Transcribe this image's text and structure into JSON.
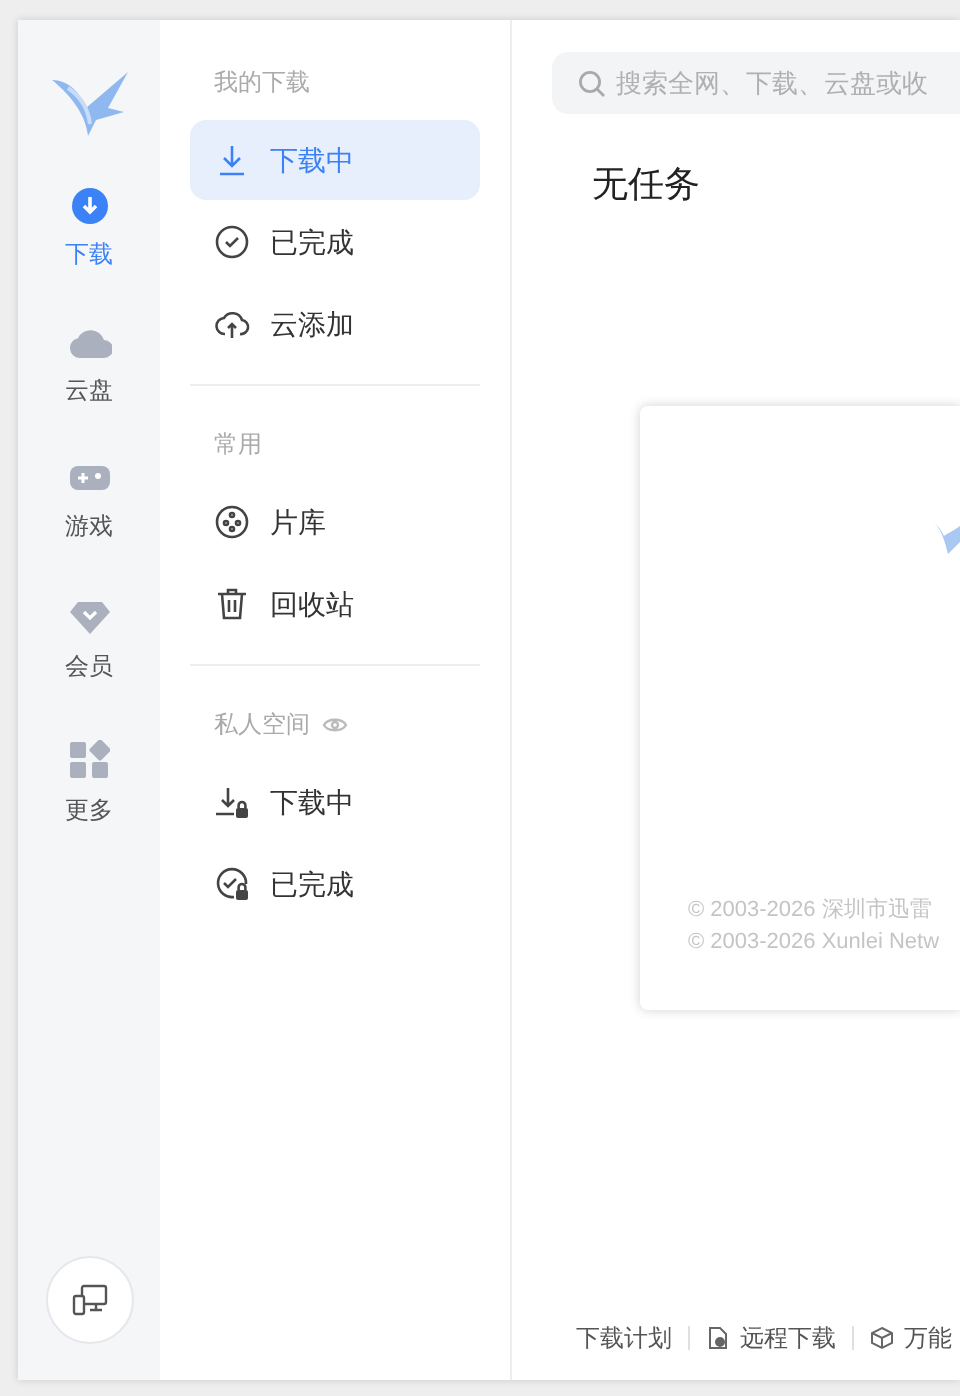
{
  "rail": [
    {
      "kind": "download",
      "label": "下载",
      "selected": true
    },
    {
      "kind": "cloud",
      "label": "云盘",
      "selected": false
    },
    {
      "kind": "game",
      "label": "游戏",
      "selected": false
    },
    {
      "kind": "vip",
      "label": "会员",
      "selected": false
    },
    {
      "kind": "more",
      "label": "更多",
      "selected": false
    }
  ],
  "sections": [
    {
      "title": "我的下载",
      "items": [
        {
          "kind": "downloading",
          "label": "下载中",
          "selected": true
        },
        {
          "kind": "done",
          "label": "已完成",
          "selected": false
        },
        {
          "kind": "cloud_add",
          "label": "云添加",
          "selected": false
        }
      ]
    },
    {
      "title": "常用",
      "items": [
        {
          "kind": "library",
          "label": "片库",
          "selected": false
        },
        {
          "kind": "trash",
          "label": "回收站",
          "selected": false
        }
      ]
    },
    {
      "title": "私人空间",
      "eye": true,
      "items": [
        {
          "kind": "private_downloading",
          "label": "下载中",
          "selected": false
        },
        {
          "kind": "private_done",
          "label": "已完成",
          "selected": false
        }
      ]
    }
  ],
  "search": {
    "placeholder": "搜索全网、下载、云盘或收"
  },
  "heading": "无任务",
  "copyright": [
    "© 2003-2026 深圳市迅雷",
    "© 2003-2026 Xunlei Netw"
  ],
  "footer": [
    {
      "kind": "plan",
      "label": "下载计划"
    },
    {
      "kind": "remote",
      "label": "远程下载"
    },
    {
      "kind": "tool",
      "label": "万能"
    }
  ]
}
